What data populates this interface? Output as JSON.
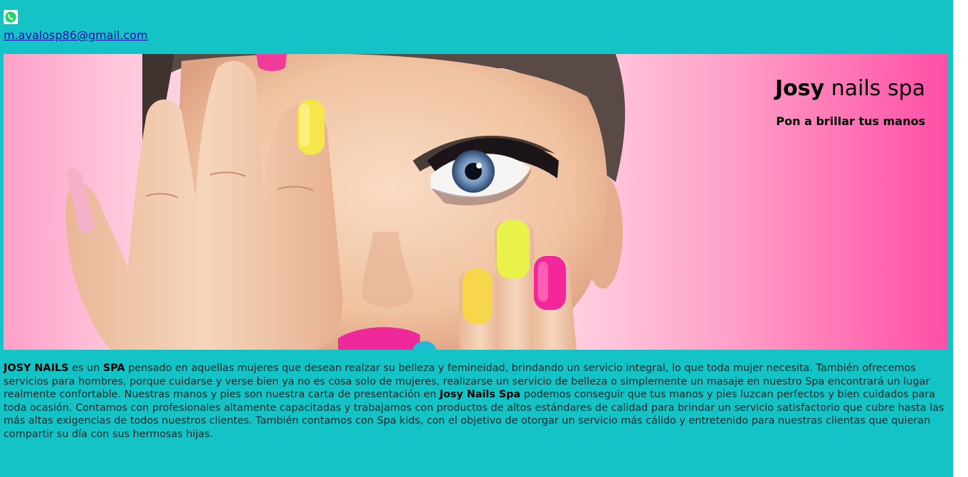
{
  "header": {
    "whatsapp_icon": "whatsapp-icon",
    "email": "m.avalosp86@gmail.com"
  },
  "hero": {
    "title_bold": "Josy",
    "title_rest": " nails spa",
    "subtitle": "Pon a brillar tus manos",
    "image": "woman-painted-nails-photo"
  },
  "description": {
    "p1_bold": "JOSY NAILS",
    "p1_text": " es un ",
    "p2_bold": "SPA",
    "p2_text": " pensado en aquellas mujeres que desean realzar su belleza y femineidad, brindando un servicio integral, lo que toda mujer necesita. También ofrecemos servicios para hombres, porque cuidarse y verse bien ya no es cosa solo de mujeres, realizarse un servicio de belleza o simplemente un masaje en nuestro Spa encontrará un lugar realmente confortable. Nuestras manos y pies son nuestra carta de presentación en ",
    "p3_bold": "Josy Nails Spa",
    "p3_text": " podemos conseguir que tus manos y pies luzcan perfectos y bien cuidados para toda ocasión. Contamos con profesionales altamente capacitadas y trabajamos con productos de altos estándares de calidad para brindar un servicio satisfactorio que cubre hasta las más altas exigencias de todos nuestros clientes. También contamos con Spa kids, con el objetivo de otorgar un servicio más cálido y entretenido para nuestras clientas que quieran compartir su día con sus hermosas hijas."
  },
  "colors": {
    "page_background": "#14c3c6",
    "link": "#1a0dab",
    "hero_pink": "#ff4ea6"
  }
}
